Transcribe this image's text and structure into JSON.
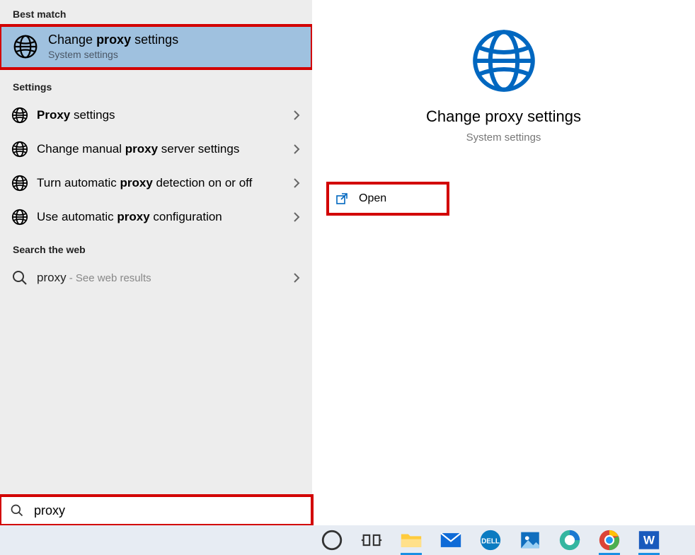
{
  "sections": {
    "best_match": "Best match",
    "settings": "Settings",
    "search_web": "Search the web"
  },
  "best_match": {
    "title_pre": "Change ",
    "title_bold": "proxy",
    "title_post": " settings",
    "subtitle": "System settings"
  },
  "settings_items": [
    {
      "pre": "",
      "bold": "Proxy",
      "post": " settings"
    },
    {
      "pre": "Change manual ",
      "bold": "proxy",
      "post": " server settings"
    },
    {
      "pre": "Turn automatic ",
      "bold": "proxy",
      "post": " detection on or off"
    },
    {
      "pre": "Use automatic ",
      "bold": "proxy",
      "post": " configuration"
    }
  ],
  "web_item": {
    "term": "proxy",
    "suffix": " - See web results"
  },
  "preview": {
    "title": "Change proxy settings",
    "subtitle": "System settings",
    "actions": [
      {
        "label": "Open"
      }
    ]
  },
  "search": {
    "value": "proxy"
  },
  "taskbar": {
    "items": [
      "cortana-icon",
      "task-view-icon",
      "file-explorer-icon",
      "mail-icon",
      "dell-icon",
      "photos-icon",
      "edge-icon",
      "chrome-icon",
      "word-icon"
    ]
  }
}
